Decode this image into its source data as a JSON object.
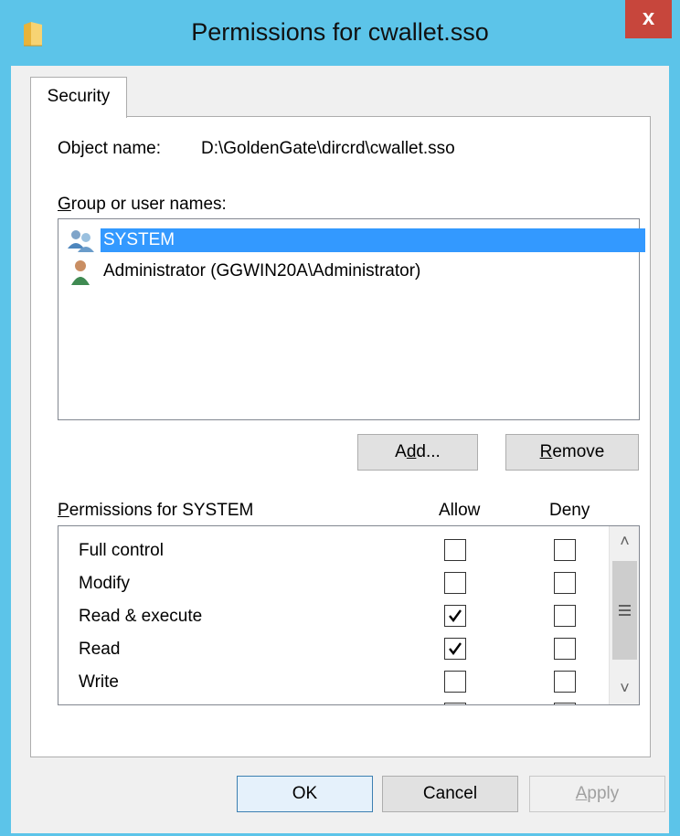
{
  "window": {
    "title": "Permissions for cwallet.sso",
    "close_label": "x"
  },
  "tabs": [
    {
      "label": "Security"
    }
  ],
  "object": {
    "label": "Object name:",
    "value": "D:\\GoldenGate\\dircrd\\cwallet.sso"
  },
  "groups": {
    "label_prefix": "",
    "label_underline": "G",
    "label_rest": "roup or user names:",
    "items": [
      {
        "name": "SYSTEM",
        "icon": "users-group-icon",
        "selected": true
      },
      {
        "name": "Administrator (GGWIN20A\\Administrator)",
        "icon": "user-icon",
        "selected": false
      }
    ]
  },
  "buttons": {
    "add_pre": "A",
    "add_under": "d",
    "add_post": "d...",
    "remove_under": "R",
    "remove_post": "emove",
    "ok": "OK",
    "cancel": "Cancel",
    "apply_under": "A",
    "apply_post": "pply"
  },
  "permissions": {
    "label_under": "P",
    "label_rest": "ermissions for SYSTEM",
    "allow_header": "Allow",
    "deny_header": "Deny",
    "rows": [
      {
        "name": "Full control",
        "allow": false,
        "deny": false
      },
      {
        "name": "Modify",
        "allow": false,
        "deny": false
      },
      {
        "name": "Read & execute",
        "allow": true,
        "deny": false
      },
      {
        "name": "Read",
        "allow": true,
        "deny": false
      },
      {
        "name": "Write",
        "allow": false,
        "deny": false
      }
    ]
  },
  "colors": {
    "frame": "#5cc4e9",
    "close": "#c7463c",
    "selection": "#3399ff"
  }
}
